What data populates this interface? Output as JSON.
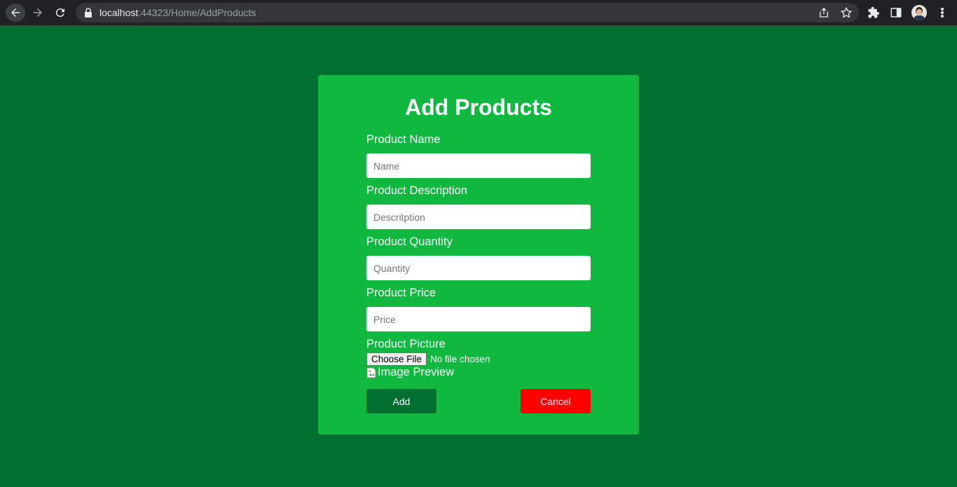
{
  "browser": {
    "url_host": "localhost",
    "url_rest": ":44323/Home/AddProducts"
  },
  "form": {
    "title": "Add Products",
    "fields": [
      {
        "label": "Product Name",
        "placeholder": "Name",
        "value": ""
      },
      {
        "label": "Product Description",
        "placeholder": "Descritption",
        "value": ""
      },
      {
        "label": "Product Quantity",
        "placeholder": "Quantity",
        "value": ""
      },
      {
        "label": "Product Price",
        "placeholder": "Price",
        "value": ""
      }
    ],
    "picture": {
      "label": "Product Picture",
      "button_label": "Choose File",
      "status": "No file chosen",
      "preview_alt": "Image Preview"
    },
    "add_label": "Add",
    "cancel_label": "Cancel"
  },
  "colors": {
    "page_background": "#006f2f",
    "card_background": "#10b840",
    "add_button": "#006f2f",
    "cancel_button": "#ff0000"
  }
}
